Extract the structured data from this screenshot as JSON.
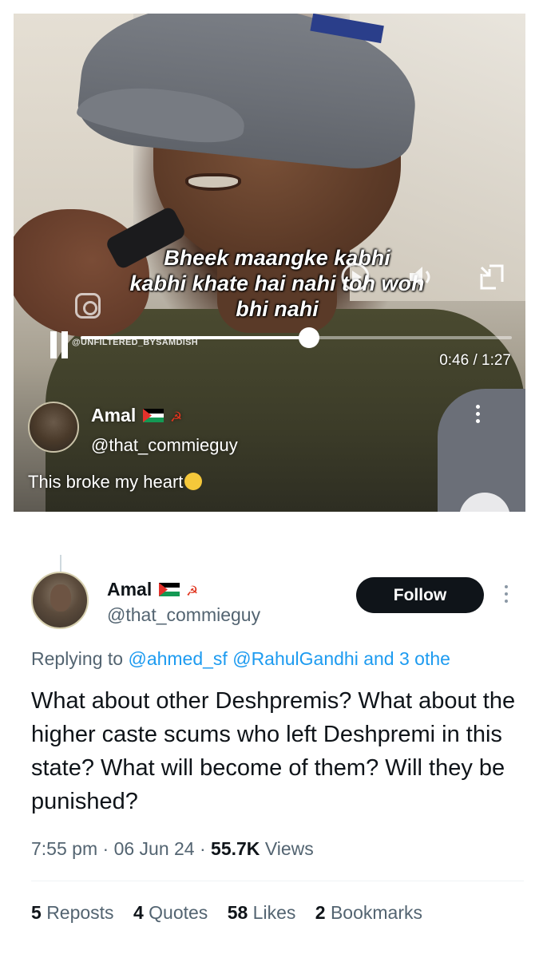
{
  "video": {
    "caption_line1": "Bheek maangke kabhi",
    "caption_line2": "kabhi khate hai nahi toh woh",
    "caption_line3": "bhi nahi",
    "watermark": "@UNFILTERED_BYSAMDISH",
    "time_current": "0:46",
    "time_total": "1:27",
    "time_display": "0:46 / 1:27",
    "progress_fraction": 0.53
  },
  "quoted_overlay": {
    "name": "Amal",
    "handle": "@that_commieguy",
    "text": "This broke my heart"
  },
  "tweet": {
    "name": "Amal",
    "handle": "@that_commieguy",
    "follow_label": "Follow",
    "replying_prefix": "Replying to",
    "mention_1": "@ahmed_sf",
    "mention_2": "@RahulGandhi",
    "mention_3": "and 3 othe",
    "body": "What about other Deshpremis? What about the higher caste scums who left Deshpremi in this state? What will become of them? Will they be punished?",
    "time": "7:55 pm",
    "date": "06 Jun 24",
    "views_count": "55.7K",
    "views_label": "Views",
    "reposts_count": "5",
    "reposts_label": "Reposts",
    "quotes_count": "4",
    "quotes_label": "Quotes",
    "likes_count": "58",
    "likes_label": "Likes",
    "bookmarks_count": "2",
    "bookmarks_label": "Bookmarks"
  },
  "colors": {
    "accent": "#1d9bf0",
    "text_primary": "#0f1419",
    "text_secondary": "#536471",
    "follow_bg": "#0f1419"
  },
  "icons": [
    "play-icon",
    "volume-icon",
    "fullscreen-exit-icon",
    "pause-icon",
    "more-vertical-icon",
    "instagram-icon",
    "flag-palestine-icon",
    "hammer-sickle-icon"
  ]
}
